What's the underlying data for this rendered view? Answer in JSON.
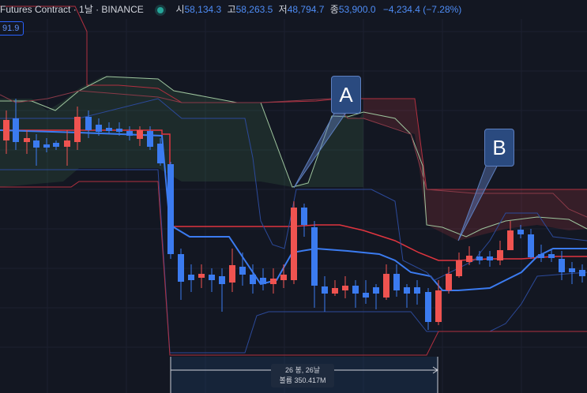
{
  "header": {
    "title": "Futures Contract · 1날 · BINANCE",
    "open_label": "시",
    "open_value": "58,134.3",
    "high_label": "고",
    "high_value": "58,263.5",
    "low_label": "저",
    "low_value": "48,794.7",
    "close_label": "종",
    "close_value": "53,900.0",
    "change": "−4,234.4 (−7.28%)"
  },
  "price_tag": "91.9",
  "callouts": {
    "a": "A",
    "b": "B"
  },
  "measure": {
    "bars": "26 봉, 26날",
    "volume": "볼륨 350.417M"
  },
  "colors": {
    "background": "#131722",
    "up": "#ef5350",
    "down": "#3b7bf0",
    "accent": "#2962ff"
  }
}
